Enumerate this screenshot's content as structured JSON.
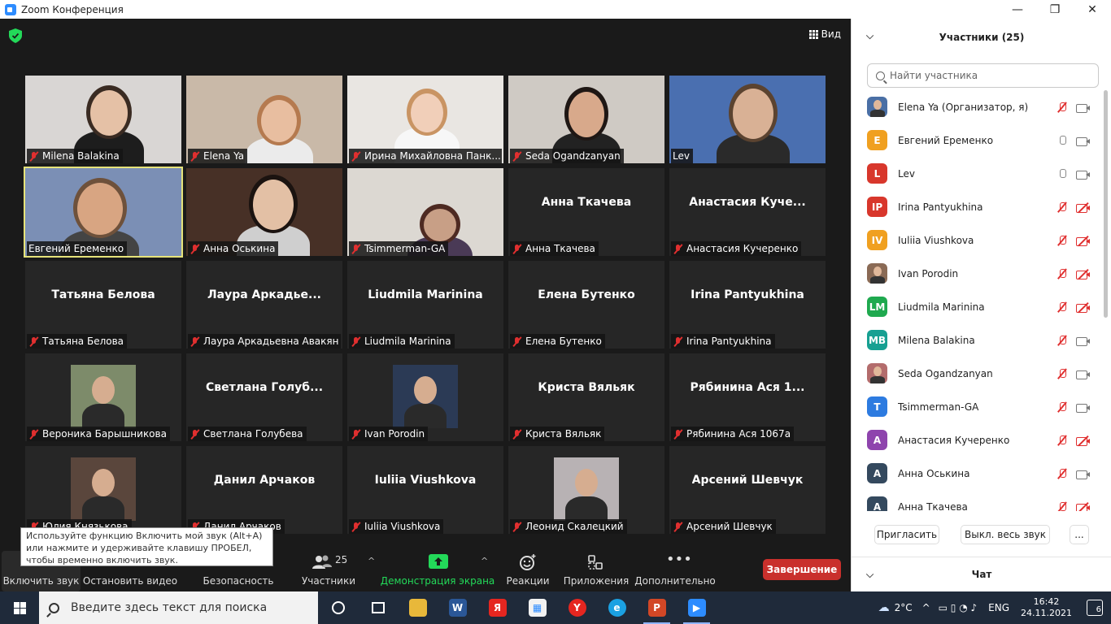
{
  "window": {
    "title": "Zoom Конференция",
    "minimize": "—",
    "maximize": "❐",
    "close": "✕"
  },
  "view_button": {
    "label": "Вид"
  },
  "tiles": [
    {
      "bigname": "",
      "label": "Milena Balakina",
      "muted": true,
      "photo": "p1"
    },
    {
      "bigname": "",
      "label": "Elena Ya",
      "muted": true,
      "photo": "p2"
    },
    {
      "bigname": "",
      "label": "Ирина Михайловна Панк...",
      "muted": true,
      "photo": "p3"
    },
    {
      "bigname": "",
      "label": "Seda Ogandzanyan",
      "muted": true,
      "photo": "p4"
    },
    {
      "bigname": "",
      "label": "Lev",
      "muted": false,
      "photo": "p5"
    },
    {
      "bigname": "",
      "label": "Евгений Еременко",
      "muted": false,
      "photo": "p6",
      "active": true
    },
    {
      "bigname": "",
      "label": "Анна Оськина",
      "muted": true,
      "photo": "p7"
    },
    {
      "bigname": "",
      "label": "Tsimmerman-GA",
      "muted": true,
      "photo": "p8"
    },
    {
      "bigname": "Анна Ткачева",
      "label": "Анна Ткачева",
      "muted": true
    },
    {
      "bigname": "Анастасия  Куче...",
      "label": "Анастасия Кучеренко",
      "muted": true
    },
    {
      "bigname": "Татьяна Белова",
      "label": "Татьяна Белова",
      "muted": true
    },
    {
      "bigname": "Лаура  Аркадье...",
      "label": "Лаура Аркадьевна Авакян",
      "muted": true
    },
    {
      "bigname": "Liudmila Marinina",
      "label": "Liudmila Marinina",
      "muted": true
    },
    {
      "bigname": "Елена Бутенко",
      "label": "Елена Бутенко",
      "muted": true
    },
    {
      "bigname": "Irina Pantyukhina",
      "label": "Irina Pantyukhina",
      "muted": true
    },
    {
      "bigname": "",
      "label": "Вероника Барышникова",
      "muted": true,
      "smallpic": "s1"
    },
    {
      "bigname": "Светлана  Голуб...",
      "label": "Светлана Голубева",
      "muted": true
    },
    {
      "bigname": "",
      "label": "Ivan Porodin",
      "muted": true,
      "smallpic": "s2"
    },
    {
      "bigname": "Криста Вяльяк",
      "label": "Криста Вяльяк",
      "muted": true
    },
    {
      "bigname": "Рябинина  Ася  1...",
      "label": "Рябинина Ася 1067а",
      "muted": true
    },
    {
      "bigname": "",
      "label": "Юлия Князькова",
      "muted": true,
      "smallpic": "s3"
    },
    {
      "bigname": "Данил Арчаков",
      "label": "Данил Арчаков",
      "muted": true
    },
    {
      "bigname": "Iuliia Viushkova",
      "label": "Iuliia Viushkova",
      "muted": true
    },
    {
      "bigname": "",
      "label": "Леонид Скалецкий",
      "muted": true,
      "smallpic": "s4"
    },
    {
      "bigname": "Арсений Шевчук",
      "label": "Арсений Шевчук",
      "muted": true
    }
  ],
  "tooltip": {
    "text": "Используйте функцию Включить мой звук (Alt+A) или нажмите и удерживайте клавишу ПРОБЕЛ, чтобы временно включить звук."
  },
  "toolbar": {
    "unmute": "Включить звук",
    "stop_video": "Остановить видео",
    "security": "Безопасность",
    "participants": "Участники",
    "participants_count": "25",
    "share": "Демонстрация экрана",
    "reactions": "Реакции",
    "apps": "Приложения",
    "more": "Дополнительно",
    "end": "Завершение"
  },
  "panel": {
    "title": "Участники (25)",
    "search_placeholder": "Найти участника",
    "participants": [
      {
        "name": "Elena Ya (Организатор, я)",
        "initials": "",
        "color": "#4a6fa5",
        "mic": "off",
        "cam": "on",
        "photo": true
      },
      {
        "name": "Евгений Еременко",
        "initials": "E",
        "color": "#f0a020",
        "mic": "on",
        "cam": "on"
      },
      {
        "name": "Lev",
        "initials": "L",
        "color": "#d8372c",
        "mic": "on",
        "cam": "on"
      },
      {
        "name": "Irina Pantyukhina",
        "initials": "IP",
        "color": "#d8372c",
        "mic": "off",
        "cam": "off"
      },
      {
        "name": "Iuliia Viushkova",
        "initials": "IV",
        "color": "#f0a020",
        "mic": "off",
        "cam": "off"
      },
      {
        "name": "Ivan Porodin",
        "initials": "",
        "color": "#8a6a55",
        "mic": "off",
        "cam": "off",
        "photo": true
      },
      {
        "name": "Liudmila Marinina",
        "initials": "LM",
        "color": "#1fa94f",
        "mic": "off",
        "cam": "off"
      },
      {
        "name": "Milena Balakina",
        "initials": "MB",
        "color": "#17a092",
        "mic": "off",
        "cam": "on"
      },
      {
        "name": "Seda Ogandzanyan",
        "initials": "",
        "color": "#b36c6c",
        "mic": "off",
        "cam": "on",
        "photo": true
      },
      {
        "name": "Tsimmerman-GA",
        "initials": "T",
        "color": "#2d7be0",
        "mic": "off",
        "cam": "on"
      },
      {
        "name": "Анастасия Кучеренко",
        "initials": "А",
        "color": "#8e44ad",
        "mic": "off",
        "cam": "off"
      },
      {
        "name": "Анна Оськина",
        "initials": "А",
        "color": "#34495e",
        "mic": "off",
        "cam": "on"
      },
      {
        "name": "Анна Ткачева",
        "initials": "А",
        "color": "#34495e",
        "mic": "off",
        "cam": "off"
      }
    ],
    "invite": "Пригласить",
    "mute_all": "Выкл. весь звук",
    "more": "...",
    "chat": "Чат"
  },
  "taskbar": {
    "search_placeholder": "Введите здесь текст для поиска",
    "weather": "2°C",
    "lang": "ENG",
    "time": "16:42",
    "date": "24.11.2021",
    "notifications": "6"
  }
}
